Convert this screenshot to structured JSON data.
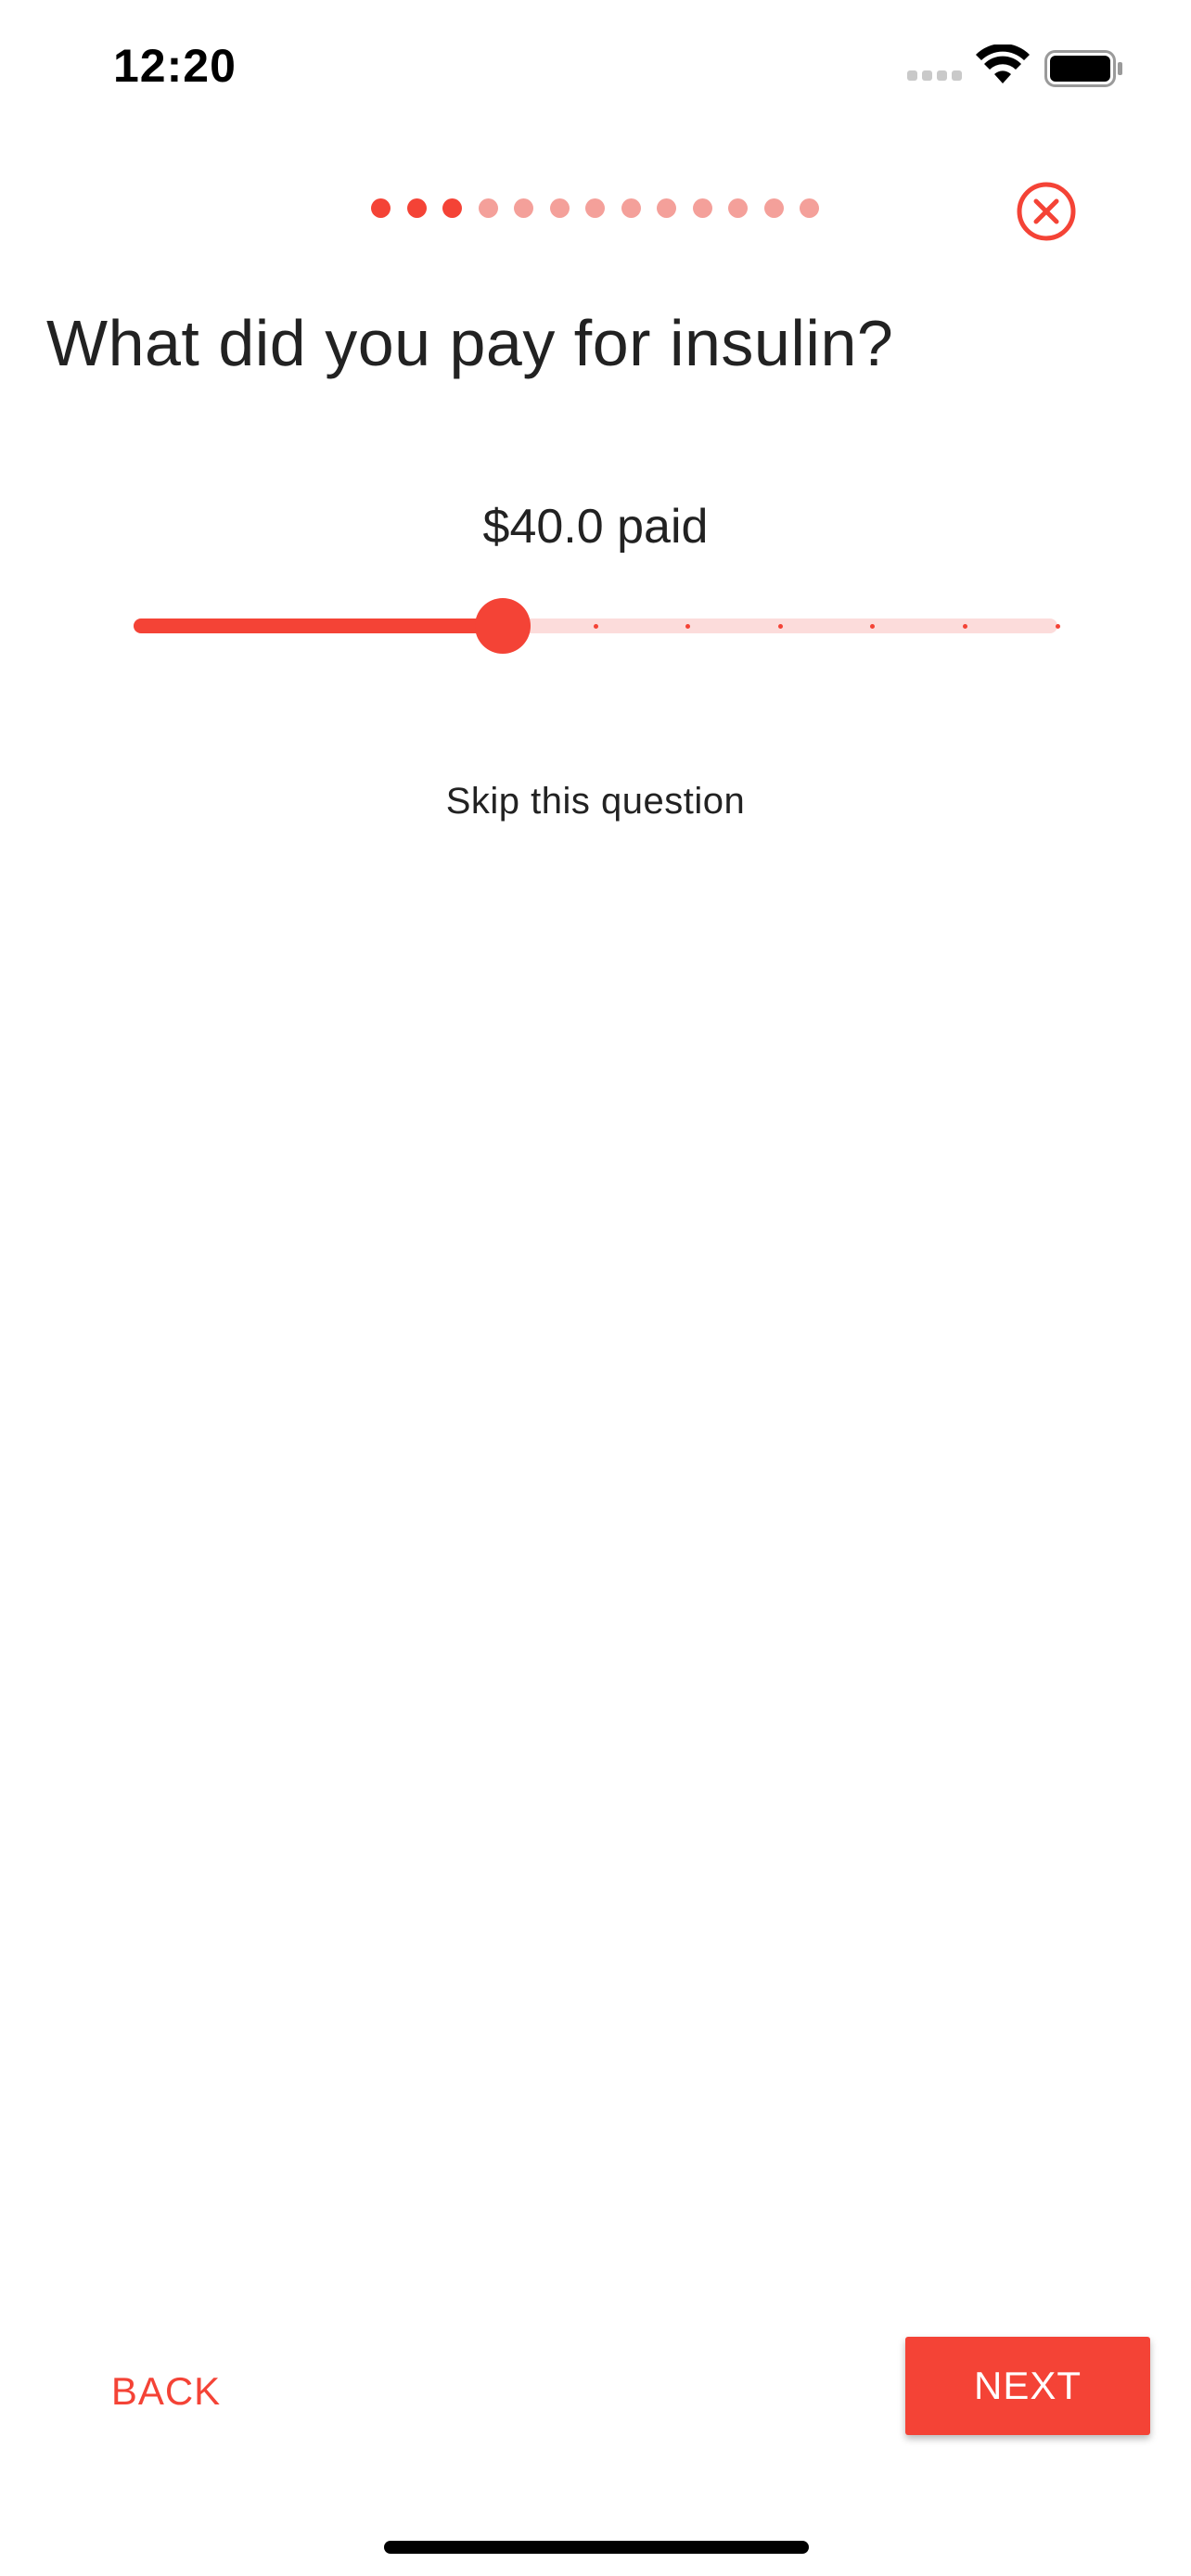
{
  "status_bar": {
    "time": "12:20",
    "icons": [
      "cellular-signal-icon",
      "wifi-icon",
      "battery-icon"
    ]
  },
  "progress": {
    "total_steps": 13,
    "completed_steps": 3,
    "done_color": "#f44336",
    "todo_color": "#f4a09a"
  },
  "close_icon": "close-circle-icon",
  "question": {
    "title": "What did you pay for insulin?",
    "value_label": "$40.0 paid"
  },
  "slider": {
    "value_fraction": 0.4,
    "divisions": 10,
    "active_color": "#f44336",
    "inactive_color": "#fcdcdb"
  },
  "skip_label": "Skip this question",
  "navigation": {
    "back_label": "BACK",
    "next_label": "NEXT"
  },
  "colors": {
    "accent": "#f44336"
  }
}
